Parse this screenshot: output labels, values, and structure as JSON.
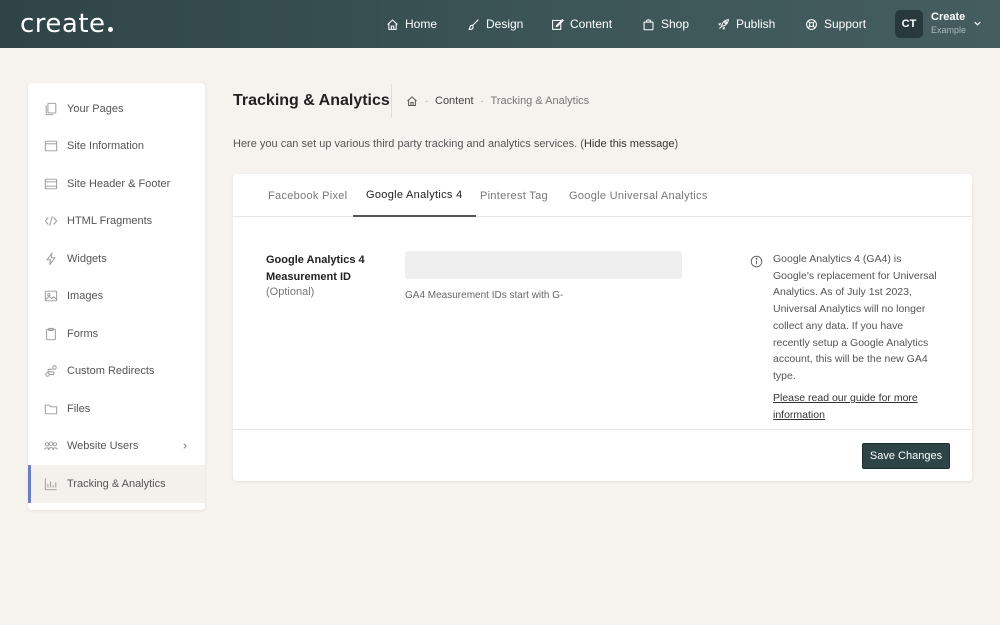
{
  "header": {
    "logo": "create",
    "nav": [
      {
        "label": "Home",
        "icon": "home-icon"
      },
      {
        "label": "Design",
        "icon": "brush-icon"
      },
      {
        "label": "Content",
        "icon": "edit-icon"
      },
      {
        "label": "Shop",
        "icon": "bag-icon"
      },
      {
        "label": "Publish",
        "icon": "rocket-icon"
      },
      {
        "label": "Support",
        "icon": "lifebuoy-icon"
      }
    ],
    "user": {
      "initials": "CT",
      "name": "Create",
      "subtitle": "Example"
    }
  },
  "sidebar": {
    "items": [
      {
        "label": "Your Pages",
        "icon": "pages-icon"
      },
      {
        "label": "Site Information",
        "icon": "window-icon"
      },
      {
        "label": "Site Header & Footer",
        "icon": "layout-icon"
      },
      {
        "label": "HTML Fragments",
        "icon": "code-icon"
      },
      {
        "label": "Widgets",
        "icon": "bolt-icon"
      },
      {
        "label": "Images",
        "icon": "image-icon"
      },
      {
        "label": "Forms",
        "icon": "clipboard-icon"
      },
      {
        "label": "Custom Redirects",
        "icon": "redirect-icon"
      },
      {
        "label": "Files",
        "icon": "folder-icon"
      },
      {
        "label": "Website Users",
        "icon": "users-icon"
      },
      {
        "label": "Tracking & Analytics",
        "icon": "chart-icon"
      }
    ],
    "active_index": 10
  },
  "page": {
    "title": "Tracking & Analytics",
    "breadcrumb": [
      "Content",
      "Tracking & Analytics"
    ],
    "intro": "Here you can set up various third party tracking and analytics services.",
    "hide_open": "(",
    "hide_label": "Hide this message",
    "hide_close": ")"
  },
  "tabs": [
    {
      "label": "Facebook  Pixel"
    },
    {
      "label": "Google  Analytics 4"
    },
    {
      "label": "Pinterest  Tag"
    },
    {
      "label": "Google  Universal  Analytics"
    }
  ],
  "form": {
    "label": "Google Analytics 4 Measurement ID",
    "optional": "(Optional)",
    "value": "",
    "placeholder": "",
    "hint": "GA4 Measurement IDs start with G-",
    "info": "Google Analytics 4 (GA4) is Google's replacement for Universal Analytics. As of July 1st 2023, Universal Analytics will no longer collect any data. If you have recently setup a Google Analytics account, this will be the new GA4 type.",
    "info_link": "Please read our guide for more information",
    "save_label": "Save Changes"
  }
}
